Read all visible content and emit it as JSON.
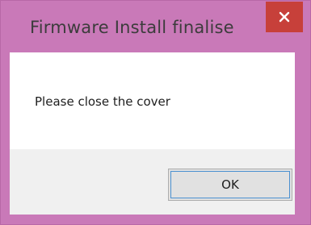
{
  "dialog": {
    "title": "Firmware Install finalise",
    "message": "Please close the cover",
    "ok_label": "OK",
    "close_icon": "close-icon"
  },
  "colors": {
    "frame": "#c979b8",
    "close_button": "#c7403a",
    "footer": "#f0f0f0",
    "button_face": "#e1e1e1"
  }
}
